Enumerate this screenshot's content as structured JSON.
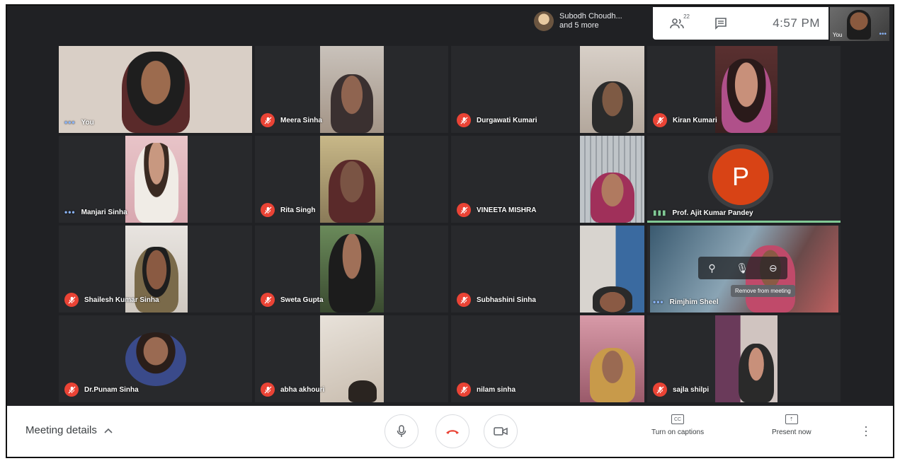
{
  "topbar": {
    "presenting_name": "Subodh Choudh...",
    "presenting_more": "and 5 more",
    "people_count": "22",
    "time": "4:57 PM",
    "self_label": "You"
  },
  "participants": [
    {
      "name": "You",
      "status": "more"
    },
    {
      "name": "Meera Sinha",
      "status": "muted"
    },
    {
      "name": "Durgawati Kumari",
      "status": "muted"
    },
    {
      "name": "Kiran Kumari",
      "status": "muted"
    },
    {
      "name": "Manjari Sinha",
      "status": "more"
    },
    {
      "name": "Rita Singh",
      "status": "muted"
    },
    {
      "name": "VINEETA MISHRA",
      "status": "muted"
    },
    {
      "name": "Prof. Ajit Kumar Pandey",
      "status": "speaking",
      "avatar_letter": "P"
    },
    {
      "name": "Shailesh Kumar Sinha",
      "status": "muted"
    },
    {
      "name": "Sweta Gupta",
      "status": "muted"
    },
    {
      "name": "Subhashini Sinha",
      "status": "muted"
    },
    {
      "name": "Rimjhim Sheel",
      "status": "more"
    },
    {
      "name": "Dr.Punam Sinha",
      "status": "muted"
    },
    {
      "name": "abha akhouri",
      "status": "muted"
    },
    {
      "name": "nilam sinha",
      "status": "muted"
    },
    {
      "name": "sajla shilpi",
      "status": "muted"
    }
  ],
  "hover_tooltip": "Remove from meeting",
  "bottombar": {
    "meeting_details": "Meeting details",
    "captions": "Turn on captions",
    "present": "Present now"
  },
  "colors": {
    "background": "#202124",
    "tile": "#3c4043",
    "muted_red": "#ea4335",
    "hangup_red": "#ea4335",
    "speaking_green": "#81c995",
    "avatar_p": "#d84315"
  }
}
